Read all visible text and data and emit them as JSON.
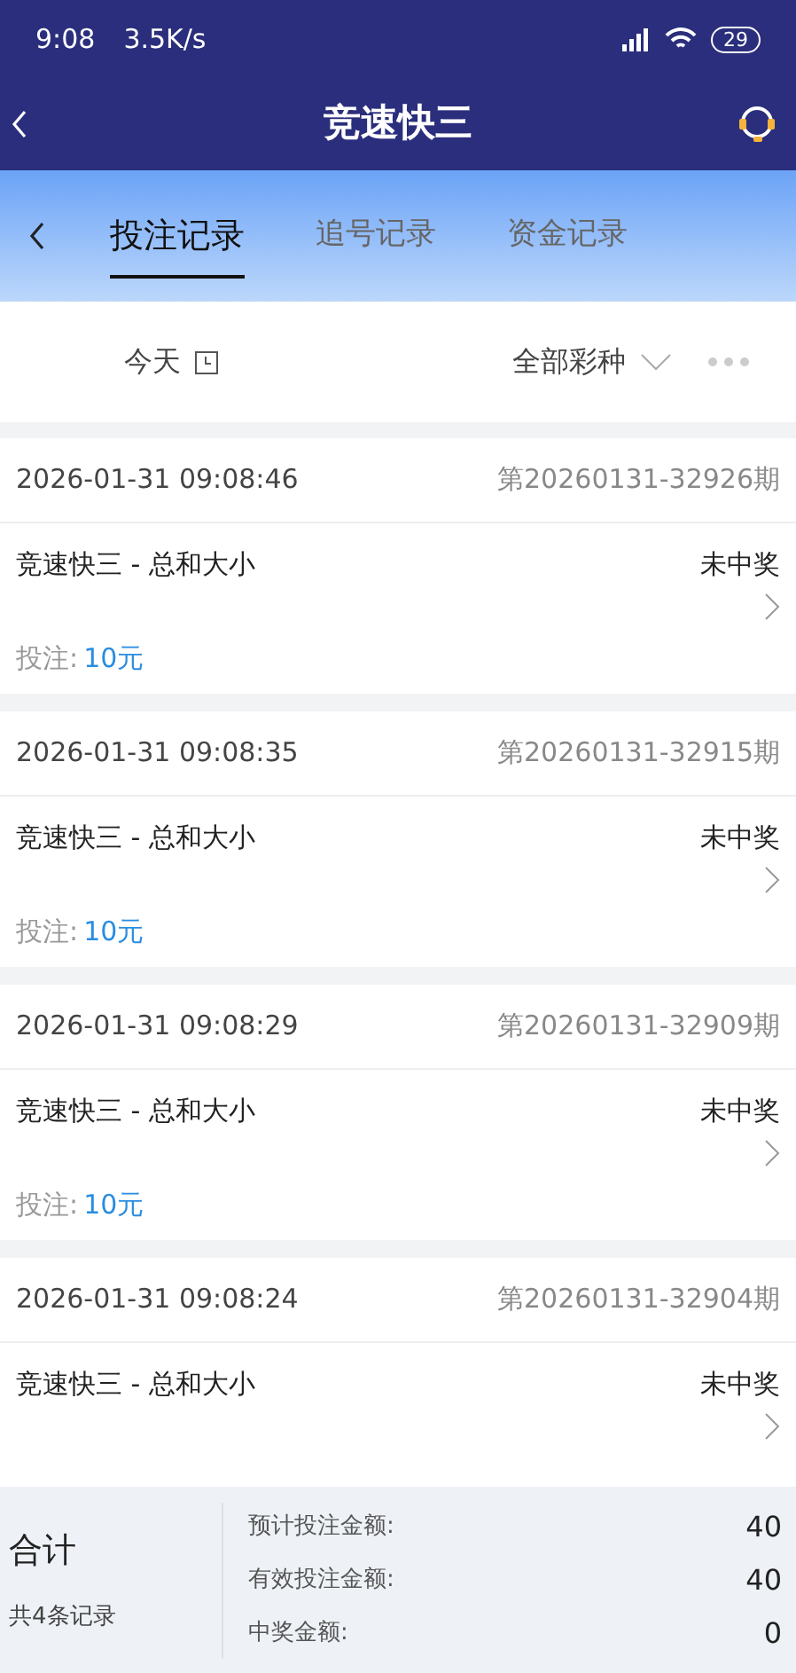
{
  "status_bar": {
    "time": "9:08",
    "speed": "3.5K/s",
    "battery": "29"
  },
  "header": {
    "title": "竞速快三"
  },
  "tabs": [
    {
      "label": "投注记录",
      "selected": true
    },
    {
      "label": "追号记录",
      "selected": false
    },
    {
      "label": "资金记录",
      "selected": false
    }
  ],
  "filters": {
    "date": "今天",
    "lottery": "全部彩种"
  },
  "records": [
    {
      "time": "2026-01-31 09:08:46",
      "issue": "第20260131-32926期",
      "game": "竞速快三 - 总和大小",
      "result": "未中奖",
      "bet_label": "投注:",
      "bet_amount": "10元"
    },
    {
      "time": "2026-01-31 09:08:35",
      "issue": "第20260131-32915期",
      "game": "竞速快三 - 总和大小",
      "result": "未中奖",
      "bet_label": "投注:",
      "bet_amount": "10元"
    },
    {
      "time": "2026-01-31 09:08:29",
      "issue": "第20260131-32909期",
      "game": "竞速快三 - 总和大小",
      "result": "未中奖",
      "bet_label": "投注:",
      "bet_amount": "10元"
    },
    {
      "time": "2026-01-31 09:08:24",
      "issue": "第20260131-32904期",
      "game": "竞速快三 - 总和大小",
      "result": "未中奖"
    }
  ],
  "summary": {
    "title": "合计",
    "count": "共4条记录",
    "rows": [
      {
        "label": "预计投注金额:",
        "value": "40"
      },
      {
        "label": "有效投注金额:",
        "value": "40"
      },
      {
        "label": "中奖金额:",
        "value": "0"
      }
    ]
  }
}
